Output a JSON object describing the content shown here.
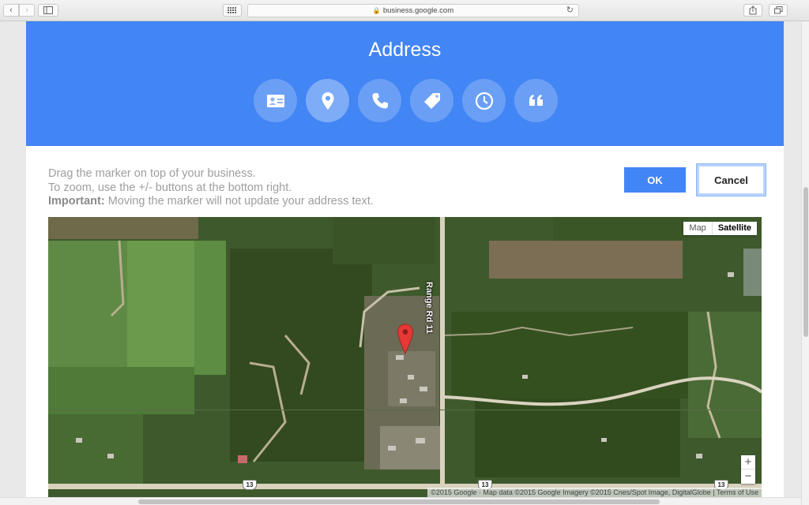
{
  "browser": {
    "url": "business.google.com",
    "back_glyph": "‹",
    "forward_glyph": "›",
    "reload_glyph": "↻"
  },
  "header": {
    "title": "Address",
    "steps": [
      {
        "icon": "contact-card-icon",
        "active": false
      },
      {
        "icon": "location-pin-icon",
        "active": true
      },
      {
        "icon": "phone-icon",
        "active": false
      },
      {
        "icon": "tag-icon",
        "active": false
      },
      {
        "icon": "clock-icon",
        "active": false
      },
      {
        "icon": "quote-icon",
        "active": false
      }
    ]
  },
  "instructions": {
    "line1": "Drag the marker on top of your business.",
    "line2": "To zoom, use the +/- buttons at the bottom right.",
    "important_label": "Important:",
    "important_text": " Moving the marker will not update your address text."
  },
  "actions": {
    "ok_label": "OK",
    "cancel_label": "Cancel"
  },
  "map": {
    "type_map": "Map",
    "type_satellite": "Satellite",
    "selected_type": "Satellite",
    "road_label": "Range Rd 11",
    "highway_number": "13",
    "zoom_in": "+",
    "zoom_out": "−",
    "attribution": "©2015 Google · Map data ©2015 Google Imagery ©2015 Cnes/Spot Image, DigitalGlobe | Terms of Use"
  },
  "colors": {
    "header": "#4285f4",
    "ok_button": "#4285f4",
    "marker": "#e53935"
  }
}
